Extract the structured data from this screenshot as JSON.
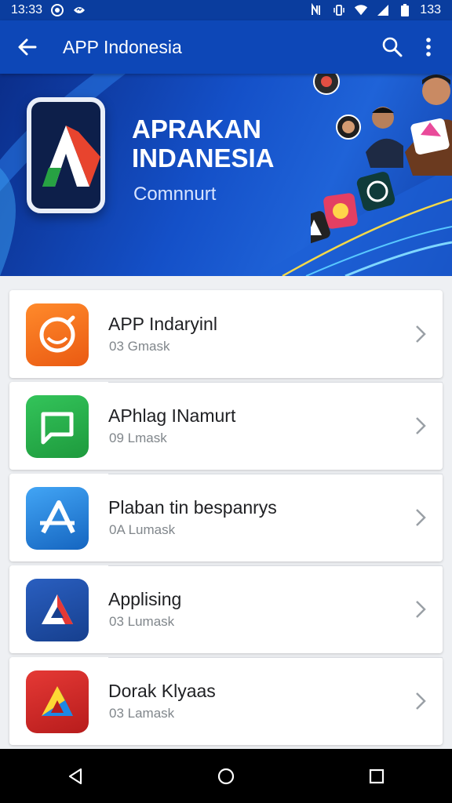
{
  "status_bar": {
    "time": "13:33",
    "right_text": "133",
    "icons": [
      "whatsapp-icon",
      "messenger-icon",
      "nfc-icon",
      "vibrate-icon",
      "wifi-icon",
      "signal-icon",
      "battery-icon"
    ]
  },
  "app_bar": {
    "title": "APP Indonesia",
    "icons": [
      "back-arrow-icon",
      "search-icon",
      "more-vert-icon"
    ]
  },
  "banner": {
    "title": "APRAKAN\nINDANESIA",
    "subtitle": "Comnnurt"
  },
  "apps": [
    {
      "name": "APP Indaryinl",
      "meta": "03 Gmask",
      "icon": "smile-bubble-icon",
      "color": "#f26b1d"
    },
    {
      "name": "APhlag INamurt",
      "meta": "09 Lmask",
      "icon": "chat-bubble-icon",
      "color": "#2bb24c"
    },
    {
      "name": "Plaban tin bespanrys",
      "meta": "0A Lumask",
      "icon": "app-a-icon",
      "color": "#1e88e5"
    },
    {
      "name": "Applising",
      "meta": "03 Lumask",
      "icon": "triangle-a-icon",
      "color": "#1e4fa8"
    },
    {
      "name": "Dorak Klyaas",
      "meta": "03 Lamask",
      "icon": "colorful-a-icon",
      "color": "#c62828"
    }
  ],
  "nav_bar": {
    "icons": [
      "back-nav-icon",
      "home-nav-icon",
      "recents-nav-icon"
    ]
  }
}
